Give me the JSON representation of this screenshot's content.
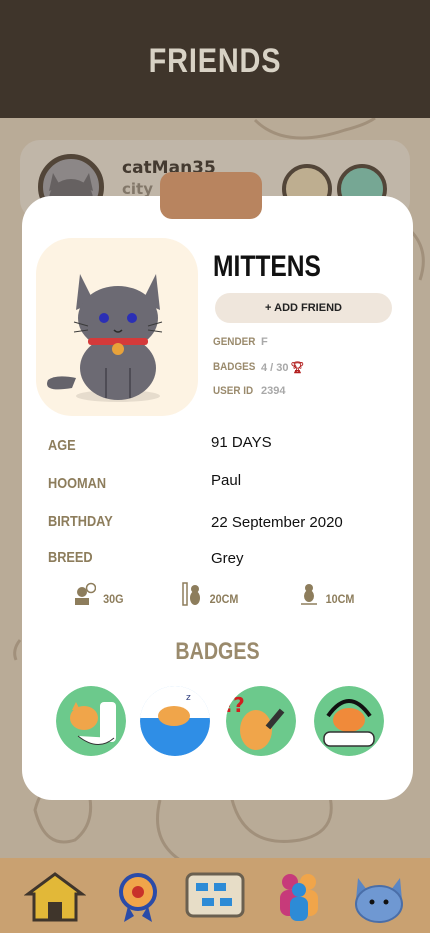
{
  "header": {
    "title": "FRIENDS"
  },
  "background_friend": {
    "username": "catMan35",
    "city": "city"
  },
  "profile": {
    "name": "MITTENS",
    "add_friend_label": "+ ADD FRIEND",
    "gender_label": "GENDER",
    "gender": "F",
    "badges_label": "BADGES",
    "badges_value": "4 / 30",
    "user_id_label": "USER ID",
    "user_id": "2394"
  },
  "details": [
    {
      "label": "AGE",
      "value": "91 DAYS"
    },
    {
      "label": "HOOMAN",
      "value": "Paul"
    },
    {
      "label": "BIRTHDAY",
      "value": "22 September 2020"
    },
    {
      "label": "BREED",
      "value": "Grey"
    }
  ],
  "stats": {
    "weight": "30G",
    "height": "20CM",
    "length": "10CM"
  },
  "badges": {
    "title": "BADGES",
    "items": [
      "toilet-cat-badge-icon",
      "sleeping-cat-badge-icon",
      "vet-injection-badge-icon",
      "gamer-cat-badge-icon"
    ]
  },
  "nav": [
    "home-icon",
    "award-medal-icon",
    "board-icon",
    "friends-icon",
    "cat-profile-icon"
  ],
  "colors": {
    "header": "#3f352b",
    "accent": "#b8845f",
    "label": "#8d7d5c",
    "nav": "#c9a171"
  }
}
